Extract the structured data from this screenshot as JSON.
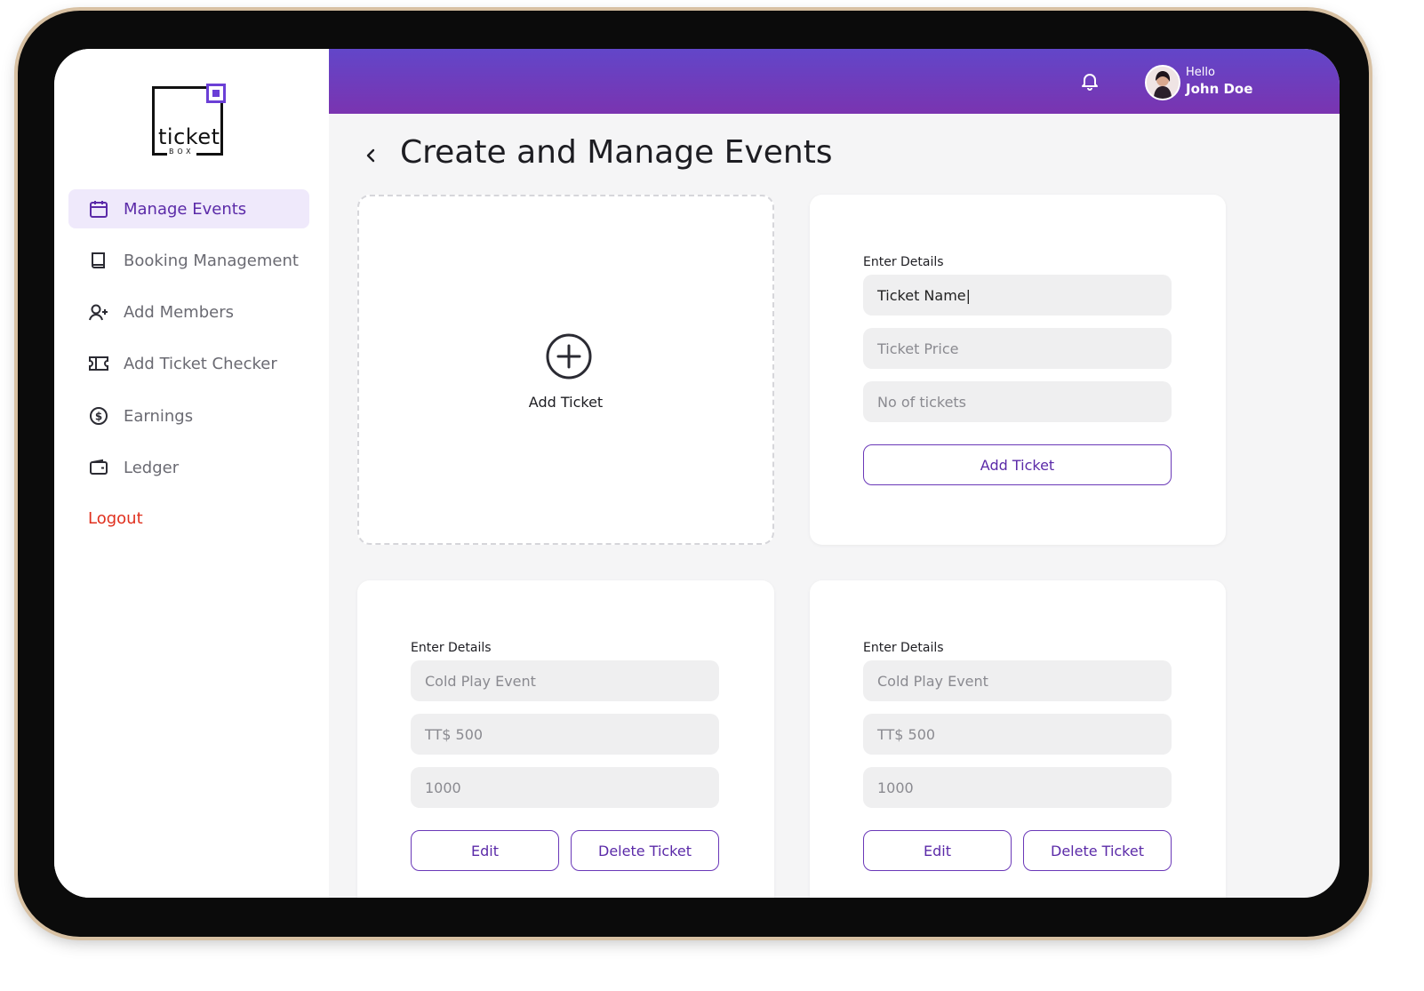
{
  "brand": {
    "logo_word": "ticket",
    "logo_sub": "BOX"
  },
  "sidebar": {
    "items": [
      {
        "label": "Manage Events",
        "icon": "calendar-icon",
        "active": true
      },
      {
        "label": "Booking Management",
        "icon": "book-icon",
        "active": false
      },
      {
        "label": "Add Members",
        "icon": "add-user-icon",
        "active": false
      },
      {
        "label": "Add Ticket Checker",
        "icon": "ticket-icon",
        "active": false
      },
      {
        "label": "Earnings",
        "icon": "dollar-circle-icon",
        "active": false
      },
      {
        "label": "Ledger",
        "icon": "wallet-icon",
        "active": false
      }
    ],
    "logout": "Logout"
  },
  "header": {
    "greeting": "Hello",
    "user_name": "John Doe",
    "notification_icon": "bell-icon"
  },
  "page": {
    "title": "Create and Manage Events",
    "back_icon": "chevron-left-icon"
  },
  "add_card": {
    "label": "Add Ticket",
    "icon": "plus-circle-icon"
  },
  "new_ticket_form": {
    "section_label": "Enter Details",
    "ticket_name_value": "Ticket Name|",
    "ticket_price_placeholder": "Ticket Price",
    "no_of_tickets_placeholder": "No of tickets",
    "submit_label": "Add Ticket"
  },
  "tickets": [
    {
      "section_label": "Enter Details",
      "name": "Cold Play Event",
      "price": "TT$ 500",
      "quantity": "1000",
      "edit_label": "Edit",
      "delete_label": "Delete Ticket"
    },
    {
      "section_label": "Enter Details",
      "name": "Cold Play Event",
      "price": "TT$ 500",
      "quantity": "1000",
      "edit_label": "Edit",
      "delete_label": "Delete Ticket"
    }
  ],
  "colors": {
    "accent": "#5b2aa8",
    "header_start": "#6246c9",
    "header_end": "#7a34b0",
    "logout": "#e0301e"
  }
}
